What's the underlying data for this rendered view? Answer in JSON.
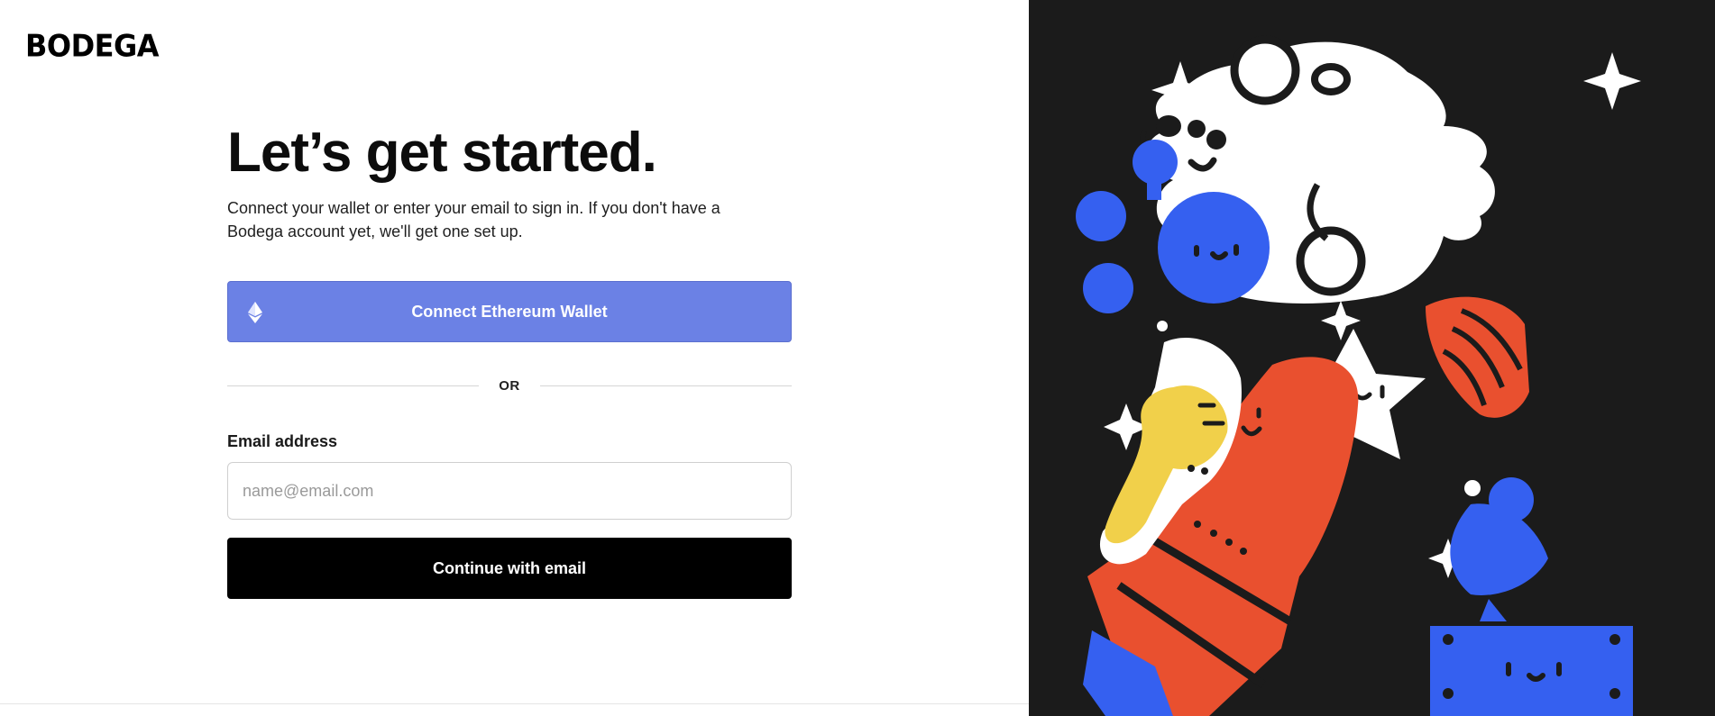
{
  "brand": {
    "logo_text": "BODEGA"
  },
  "signin": {
    "title": "Let’s get started.",
    "subtitle": "Connect your wallet or enter your email to sign in. If you don't have a Bodega account yet, we'll get one set up.",
    "wallet_button_label": "Connect Ethereum Wallet",
    "wallet_icon": "ethereum-icon",
    "divider_text": "OR",
    "email_label": "Email address",
    "email_placeholder": "name@email.com",
    "email_value": "",
    "continue_button_label": "Continue with email"
  },
  "colors": {
    "wallet_button": "#6b81e5",
    "continue_button": "#000000",
    "art_background": "#1b1b1b",
    "art_blue": "#3560f0",
    "art_red": "#e9502f",
    "art_yellow": "#f1d04a"
  }
}
